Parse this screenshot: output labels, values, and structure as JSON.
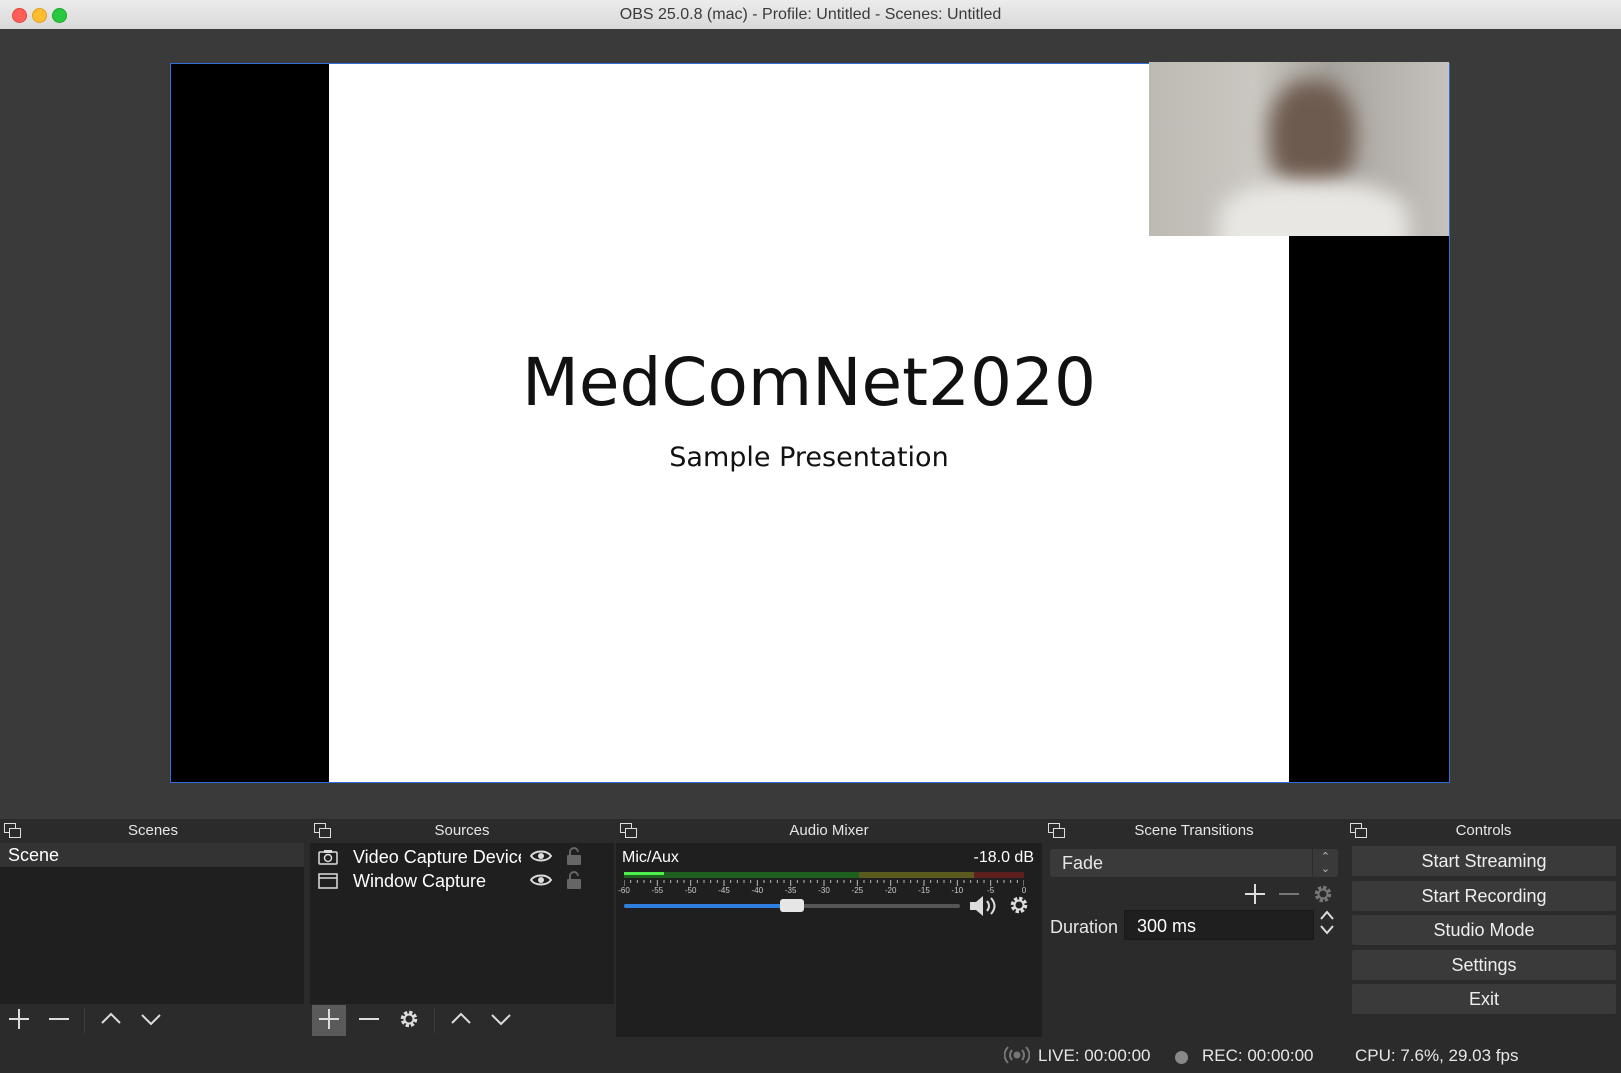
{
  "window": {
    "title": "OBS 25.0.8 (mac) - Profile: Untitled - Scenes: Untitled"
  },
  "preview": {
    "slide_title": "MedComNet2020",
    "slide_subtitle": "Sample Presentation"
  },
  "scenes": {
    "header": "Scenes",
    "items": [
      {
        "label": "Scene",
        "selected": true
      }
    ]
  },
  "sources": {
    "header": "Sources",
    "items": [
      {
        "label": "Video Capture Device",
        "icon": "camera-icon",
        "visible": true,
        "locked": true
      },
      {
        "label": "Window Capture",
        "icon": "window-icon",
        "visible": true,
        "locked": true
      }
    ]
  },
  "audio_mixer": {
    "header": "Audio Mixer",
    "channel": {
      "name": "Mic/Aux",
      "db": "-18.0 dB",
      "volume": 0.5,
      "level": 0.1
    },
    "scale": [
      "-60",
      "-55",
      "-50",
      "-45",
      "-40",
      "-35",
      "-30",
      "-25",
      "-20",
      "-15",
      "-10",
      "-5",
      "0"
    ]
  },
  "scene_transitions": {
    "header": "Scene Transitions",
    "selected": "Fade",
    "duration_label": "Duration",
    "duration_value": "300 ms"
  },
  "controls": {
    "header": "Controls",
    "start_streaming": "Start Streaming",
    "start_recording": "Start Recording",
    "studio_mode": "Studio Mode",
    "settings": "Settings",
    "exit": "Exit"
  },
  "status": {
    "live": "LIVE: 00:00:00",
    "rec": "REC: 00:00:00",
    "cpu": "CPU: 7.6%, 29.03 fps"
  }
}
